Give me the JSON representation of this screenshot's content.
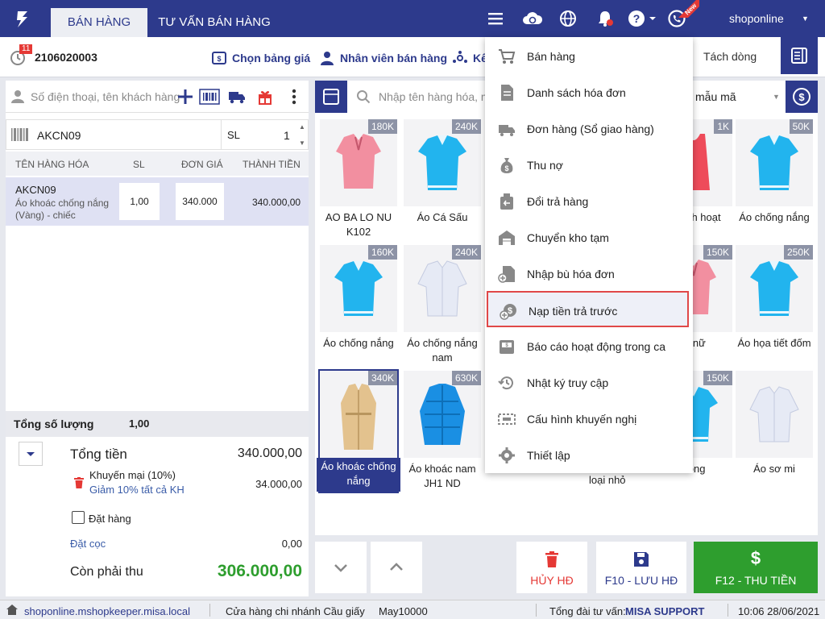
{
  "nav": {
    "tabs": [
      {
        "label": "BÁN HÀNG"
      },
      {
        "label": "TƯ VẤN BÁN HÀNG"
      }
    ],
    "new_badge": "New",
    "user": "shoponline"
  },
  "order": {
    "badge": "11",
    "number": "2106020003",
    "toolbar": [
      {
        "label": "Chọn bảng giá"
      },
      {
        "label": "Nhân viên bán hàng"
      },
      {
        "label": "Kê"
      }
    ],
    "split_label": "Tách dòng"
  },
  "cart": {
    "customer_placeholder": "Số điện thoại, tên khách hàng",
    "sku_value": "AKCN09",
    "qty_label": "SL",
    "qty_value": "1",
    "headers": [
      "TÊN HÀNG HÓA",
      "SL",
      "ĐƠN GIÁ",
      "THÀNH TIỀN"
    ],
    "line": {
      "sku": "AKCN09",
      "name": "Áo khoác chống nắng (Vàng) - chiếc",
      "qty": "1,00",
      "price": "340.000",
      "total": "340.000,00"
    }
  },
  "summary": {
    "qty_label": "Tổng số lượng",
    "qty_value": "1,00",
    "total_label": "Tổng tiền",
    "total_value": "340.000,00",
    "promo_label": "Khuyến mại (10%)",
    "promo_desc": "Giảm 10% tất cả KH",
    "promo_value": "34.000,00",
    "order_label": "Đặt hàng",
    "deposit_label": "Đặt cọc",
    "deposit_value": "0,00",
    "due_label": "Còn phải thu",
    "due_value": "306.000,00"
  },
  "products": {
    "search_placeholder": "Nhập tên hàng hóa, m",
    "filter_value": "mẫu mã",
    "items": [
      {
        "name": "AO BA LO NU K102",
        "price": "180K",
        "kind": "blouse-pink"
      },
      {
        "name": "Áo Cá Sấu",
        "price": "240K",
        "kind": "polo-blue"
      },
      {
        "name": "lỗ có h hoạt",
        "price": "1K",
        "kind": "tank-red"
      },
      {
        "name": "Áo chống nắng",
        "price": "50K",
        "kind": "polo-blue"
      },
      {
        "name": "Áo chống nắng",
        "price": "160K",
        "kind": "polo-blue"
      },
      {
        "name": "Áo chống nắng nam",
        "price": "240K",
        "kind": "shirt-white"
      },
      {
        "name": "le nữ",
        "price": "150K",
        "kind": "blouse-pink"
      },
      {
        "name": "Áo họa tiết đốm",
        "price": "250K",
        "kind": "polo-blue"
      },
      {
        "name": "Áo khoác chống nắng",
        "price": "340K",
        "kind": "coat-beige"
      },
      {
        "name": "Áo khoác nam JH1 ND",
        "price": "630K",
        "kind": "jacket-blue"
      },
      {
        "name": "hong",
        "price": "150K",
        "kind": "polo-blue"
      },
      {
        "name": "Áo sơ mi",
        "price": "",
        "kind": "shirt-white"
      }
    ],
    "extra_label": "loại nhỏ"
  },
  "actions": {
    "cancel": "HỦY HĐ",
    "save": "F10 - LƯU HĐ",
    "pay": "F12 - THU TIỀN"
  },
  "status": {
    "domain": "shoponline.mshopkeeper.misa.local",
    "branch": "Cửa hàng chi nhánh Cầu giấy",
    "machine": "May10000",
    "hotline_label": "Tổng đài tư vấn:",
    "hotline": "MISA SUPPORT",
    "datetime": "10:06 28/06/2021"
  },
  "menu": {
    "items": [
      {
        "label": "Bán hàng",
        "icon": "cart-icon"
      },
      {
        "label": "Danh sách hóa đơn",
        "icon": "document-icon"
      },
      {
        "label": "Đơn hàng (Sổ giao hàng)",
        "icon": "truck-icon"
      },
      {
        "label": "Thu nợ",
        "icon": "money-bag-icon"
      },
      {
        "label": "Đổi trả hàng",
        "icon": "return-icon"
      },
      {
        "label": "Chuyển kho tạm",
        "icon": "warehouse-icon"
      },
      {
        "label": "Nhập bù hóa đơn",
        "icon": "invoice-add-icon"
      },
      {
        "label": "Nạp tiền trả trước",
        "icon": "coin-add-icon"
      },
      {
        "label": "Báo cáo hoạt động trong ca",
        "icon": "report-icon"
      },
      {
        "label": "Nhật ký truy cập",
        "icon": "history-icon"
      },
      {
        "label": "Cấu hình khuyến nghị",
        "icon": "config-icon"
      },
      {
        "label": "Thiết lập",
        "icon": "gear-icon"
      }
    ],
    "highlighted_index": 7
  },
  "colors": {
    "brand": "#2d3a8c",
    "pay": "#2e9e2e",
    "cancel": "#e53935",
    "highlight_border": "#e04848"
  }
}
